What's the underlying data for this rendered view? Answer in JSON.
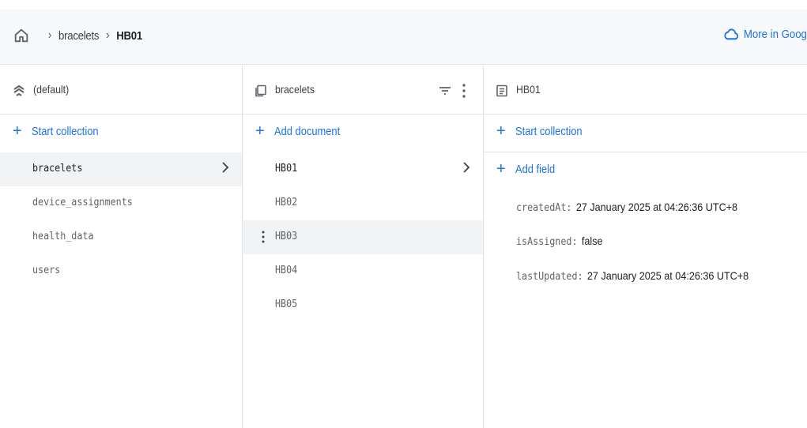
{
  "breadcrumb": {
    "items": [
      "bracelets",
      "HB01"
    ]
  },
  "header": {
    "more_link": "More in Goog"
  },
  "panel_database": {
    "title": "(default)",
    "action": "Start collection",
    "collections": [
      "bracelets",
      "device_assignments",
      "health_data",
      "users"
    ],
    "selected": "bracelets"
  },
  "panel_collection": {
    "title": "bracelets",
    "action": "Add document",
    "documents": [
      "HB01",
      "HB02",
      "HB03",
      "HB04",
      "HB05"
    ],
    "selected": "HB01",
    "hovered": "HB03"
  },
  "panel_document": {
    "title": "HB01",
    "action_collection": "Start collection",
    "action_field": "Add field",
    "fields": [
      {
        "key": "createdAt:",
        "value": "27 January 2025 at 04:26:36 UTC+8"
      },
      {
        "key": "isAssigned:",
        "value": "false"
      },
      {
        "key": "lastUpdated:",
        "value": "27 January 2025 at 04:26:36 UTC+8"
      }
    ]
  },
  "colors": {
    "accent": "#1a73e8",
    "selected_row": "#f1f3f4",
    "header_bg": "#f7f9fa"
  }
}
